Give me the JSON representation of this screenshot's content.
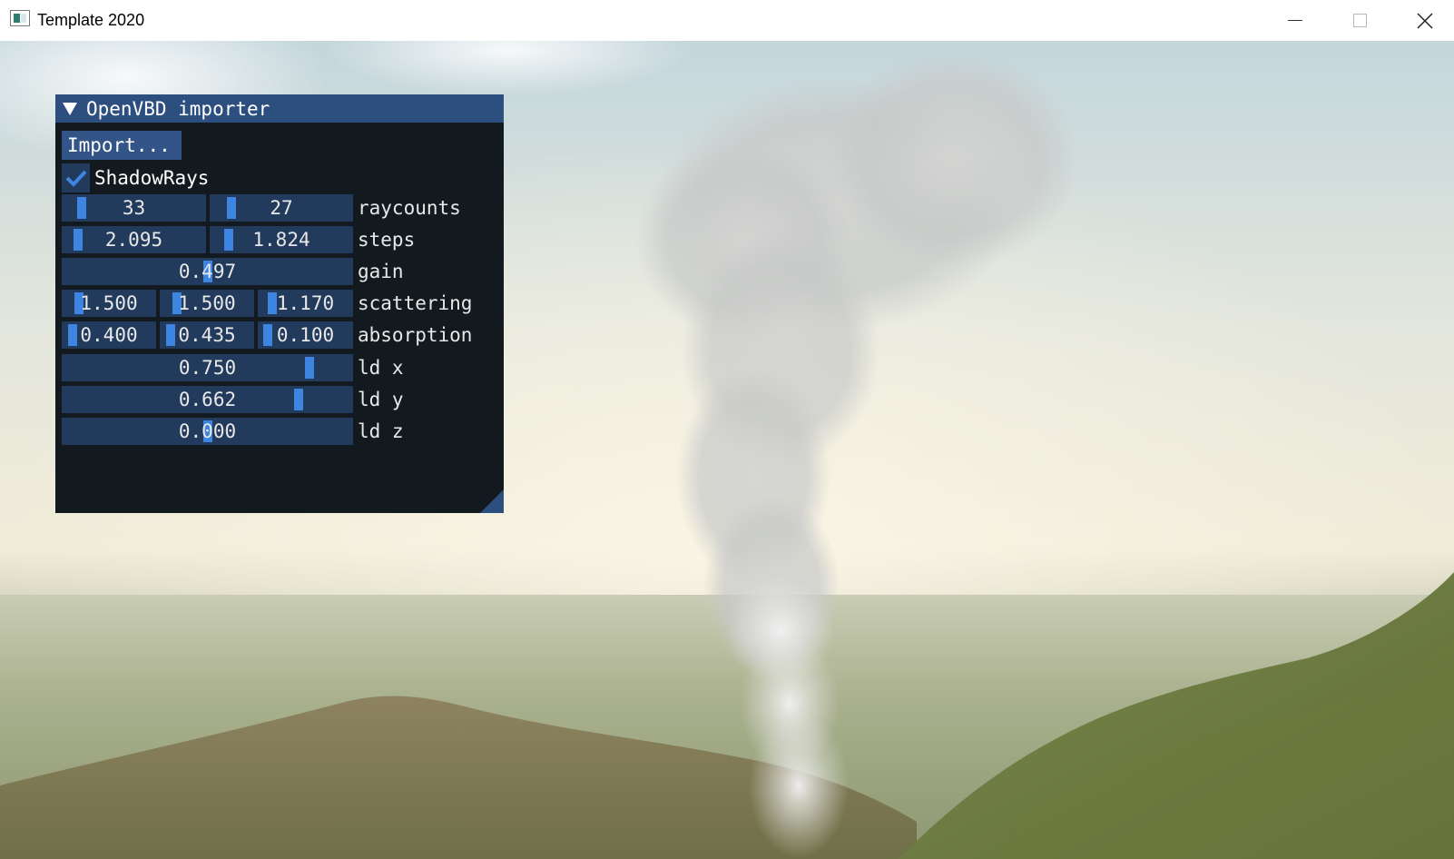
{
  "window": {
    "title": "Template 2020",
    "icon": "app-window-icon",
    "controls": [
      "minimize-icon",
      "maximize-icon",
      "close-icon"
    ]
  },
  "panel": {
    "title": "OpenVBD importer",
    "import_label": "Import...",
    "shadow_rays": {
      "label": "ShadowRays",
      "checked": true
    },
    "raycounts": {
      "label": "raycounts",
      "values": [
        "33",
        "27"
      ],
      "fractions": [
        0.1,
        0.11
      ]
    },
    "steps": {
      "label": "steps",
      "values": [
        "2.095",
        "1.824"
      ],
      "fractions": [
        0.07,
        0.09
      ]
    },
    "gain": {
      "label": "gain",
      "value": "0.497",
      "fraction": 0.5
    },
    "scattering": {
      "label": "scattering",
      "values": [
        "1.500",
        "1.500",
        "1.170"
      ],
      "fractions": [
        0.12,
        0.12,
        0.09
      ]
    },
    "absorption": {
      "label": "absorption",
      "values": [
        "0.400",
        "0.435",
        "0.100"
      ],
      "fractions": [
        0.04,
        0.04,
        0.03
      ]
    },
    "ld_x": {
      "label": "ld x",
      "value": "0.750",
      "fraction": 0.87
    },
    "ld_y": {
      "label": "ld y",
      "value": "0.662",
      "fraction": 0.83
    },
    "ld_z": {
      "label": "ld z",
      "value": "0.000",
      "fraction": 0.5
    }
  },
  "colors": {
    "panel_bg": "#131a1f",
    "title_bg": "#2d4f80",
    "frame_bg": "#223a5c",
    "grab": "#3d85e0",
    "button": "#335487"
  }
}
